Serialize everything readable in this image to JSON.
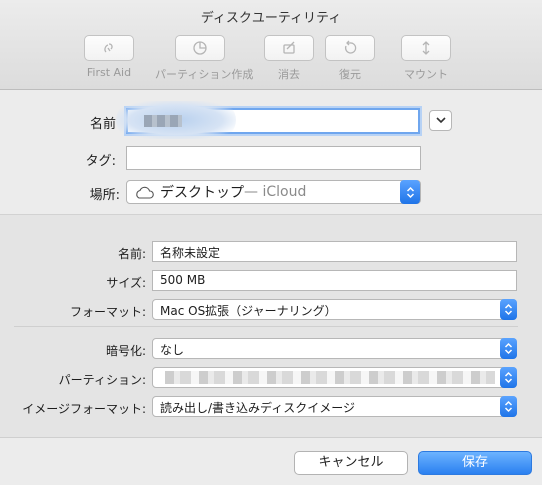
{
  "window": {
    "title": "ディスクユーティリティ"
  },
  "toolbar": {
    "items": [
      {
        "label": "First Aid",
        "icon": "first-aid-icon"
      },
      {
        "label": "パーティション作成",
        "icon": "partition-icon"
      },
      {
        "label": "消去",
        "icon": "erase-icon"
      },
      {
        "label": "復元",
        "icon": "restore-icon"
      },
      {
        "label": "マウント",
        "icon": "mount-icon"
      }
    ]
  },
  "save_form": {
    "name_label": "名前",
    "tag_label": "タグ:",
    "location_label": "場所:",
    "location_value": "デスクトップ",
    "location_suffix": " — iCloud"
  },
  "image_options": {
    "name_label": "名前:",
    "name_value": "名称未設定",
    "size_label": "サイズ:",
    "size_value": "500 MB",
    "format_label": "フォーマット:",
    "format_value": "Mac OS拡張（ジャーナリング）",
    "encryption_label": "暗号化:",
    "encryption_value": "なし",
    "partition_label": "パーティション:",
    "image_format_label": "イメージフォーマット:",
    "image_format_value": "読み出し/書き込みディスクイメージ"
  },
  "buttons": {
    "cancel": "キャンセル",
    "save": "保存"
  },
  "colors": {
    "accent": "#2a80f0",
    "focus_ring": "#6fa6ee"
  }
}
